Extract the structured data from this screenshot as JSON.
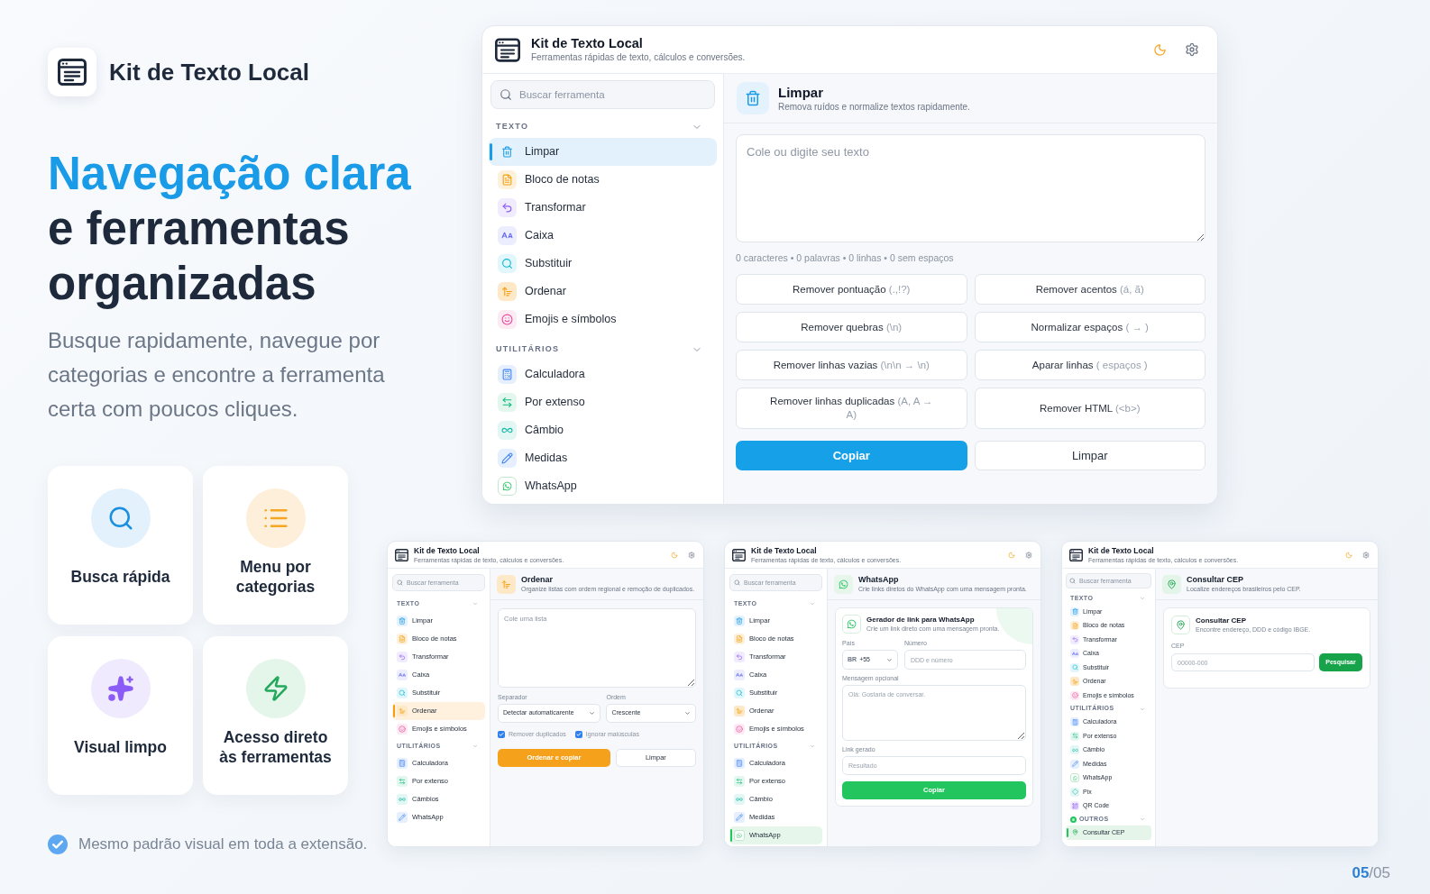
{
  "brand": {
    "name": "Kit de Texto Local"
  },
  "headline": {
    "highlight": "Navegação clara",
    "text": "e ferramentas organizadas"
  },
  "description": "Busque rapidamente, navegue por categorias e encontre a ferramenta certa com poucos cliques.",
  "features": [
    {
      "title": "Busca rápida"
    },
    {
      "title": "Menu por categorias"
    },
    {
      "title": "Visual limpo"
    },
    {
      "title": "Acesso direto às ferramentas"
    }
  ],
  "footer_note": "Mesmo padrão visual em toda a extensão.",
  "windows": [
    {
      "title": "Kit de Texto Local",
      "subtitle": "Ferramentas rápidas de texto, cálculos e conversões.",
      "sidebar": {
        "search": {
          "placeholder": "Buscar ferramenta"
        },
        "sections": [
          {
            "label": "TEXTO",
            "expanded": true,
            "items": [
              {
                "label": "Limpar",
                "selected": true
              },
              {
                "label": "Bloco de notas",
                "selected": false
              },
              {
                "label": "Transformar",
                "selected": false
              },
              {
                "label": "Caixa",
                "selected": false
              },
              {
                "label": "Substituir",
                "selected": false
              },
              {
                "label": "Ordenar",
                "selected": false
              },
              {
                "label": "Emojis e símbolos",
                "selected": false
              }
            ]
          },
          {
            "label": "UTILITÁRIOS",
            "expanded": true,
            "items": [
              {
                "label": "Calculadora",
                "selected": false
              },
              {
                "label": "Por extenso",
                "selected": false
              },
              {
                "label": "Câmbio",
                "selected": false
              },
              {
                "label": "Medidas",
                "selected": false
              },
              {
                "label": "WhatsApp",
                "selected": false
              }
            ]
          }
        ]
      },
      "tool": {
        "kind": "clean",
        "title": "Limpar",
        "description": "Remova ruídos e normalize textos rapidamente.",
        "input": {
          "placeholder": "Cole ou digite seu texto"
        },
        "stats": "0 caracteres • 0 palavras • 0 linhas • 0 sem espaços",
        "actions": [
          {
            "label": "Remover pontuação",
            "hint": "(.,!?)"
          },
          {
            "label": "Remover acentos",
            "hint": "(á, ã)"
          },
          {
            "label": "Remover quebras",
            "hint": "(\\n)"
          },
          {
            "label": "Normalizar espaços",
            "hint": "( → )"
          },
          {
            "label": "Remover linhas vazias",
            "hint": "(\\n\\n → \\n)"
          },
          {
            "label": "Aparar linhas",
            "hint": "( espaços )"
          },
          {
            "label": "Remover linhas duplicadas",
            "hint": "(A, A → A)"
          },
          {
            "label": "Remover HTML",
            "hint": "(<b>)"
          }
        ],
        "buttons": [
          {
            "label": "Copiar",
            "kind": "primary"
          },
          {
            "label": "Limpar",
            "kind": "secondary"
          }
        ]
      }
    },
    {
      "title": "Kit de Texto Local",
      "subtitle": "Ferramentas rápidas de texto, cálculos e conversões.",
      "sidebar": {
        "search": {
          "placeholder": "Buscar ferramenta"
        },
        "sections": [
          {
            "label": "TEXTO",
            "expanded": true,
            "items": [
              {
                "label": "Limpar",
                "selected": false
              },
              {
                "label": "Bloco de notas",
                "selected": false
              },
              {
                "label": "Transformar",
                "selected": false
              },
              {
                "label": "Caixa",
                "selected": false
              },
              {
                "label": "Substituir",
                "selected": false
              },
              {
                "label": "Ordenar",
                "selected": true
              },
              {
                "label": "Emojis e símbolos",
                "selected": false
              }
            ]
          },
          {
            "label": "UTILITÁRIOS",
            "expanded": true,
            "items": [
              {
                "label": "Calculadora",
                "selected": false
              },
              {
                "label": "Por extenso",
                "selected": false
              },
              {
                "label": "Câmbios",
                "selected": false
              },
              {
                "label": "WhatsApp",
                "selected": false
              }
            ]
          }
        ]
      },
      "tool": {
        "kind": "sort",
        "title": "Ordenar",
        "description": "Organize listas com ordem regional e remoção de duplicados.",
        "input": {
          "placeholder": "Cole uma lista"
        },
        "selects": [
          {
            "label": "Separador",
            "value": "Detectar automaticarente"
          },
          {
            "label": "Ordem",
            "value": "Crescente"
          }
        ],
        "options": [
          {
            "label": "Remover duplicados",
            "checked": true
          },
          {
            "label": "Ignorar maiúsculas",
            "checked": true
          }
        ],
        "buttons": [
          {
            "label": "Ordenar e copiar",
            "kind": "primary"
          },
          {
            "label": "Limpar",
            "kind": "secondary"
          }
        ]
      }
    },
    {
      "title": "Kit de Texto Local",
      "subtitle": "Ferramentas rápidas de texto, cálculos e conversões.",
      "sidebar": {
        "search": {
          "placeholder": "Buscar ferramenta"
        },
        "sections": [
          {
            "label": "TEXTO",
            "expanded": true,
            "items": [
              {
                "label": "Limpar",
                "selected": false
              },
              {
                "label": "Bloco de notas",
                "selected": false
              },
              {
                "label": "Transformar",
                "selected": false
              },
              {
                "label": "Caixa",
                "selected": false
              },
              {
                "label": "Substituir",
                "selected": false
              },
              {
                "label": "Ordenar",
                "selected": false
              },
              {
                "label": "Emojis e símbolos",
                "selected": false
              }
            ]
          },
          {
            "label": "UTILITÁRIOS",
            "expanded": true,
            "items": [
              {
                "label": "Calculadora",
                "selected": false
              },
              {
                "label": "Por extenso",
                "selected": false
              },
              {
                "label": "Câmbio",
                "selected": false
              },
              {
                "label": "Medidas",
                "selected": false
              },
              {
                "label": "WhatsApp",
                "selected": true
              }
            ]
          }
        ]
      },
      "tool": {
        "kind": "whatsapp",
        "title": "WhatsApp",
        "description": "Crie links diretos do WhatsApp com uma mensagem pronta.",
        "card": {
          "title": "Gerador de link para WhatsApp",
          "description": "Crie um link direto com uma mensagem pronta.",
          "country": {
            "label": "País",
            "flag": "BR",
            "value": "+55"
          },
          "phone": {
            "label": "Número",
            "placeholder": "DDD e número"
          },
          "message": {
            "label": "Mensagem opcional",
            "placeholder": "Olá: Gostaria de conversar."
          },
          "link": {
            "label": "Link gerado",
            "placeholder": "Resultado"
          },
          "button": {
            "label": "Copiar"
          }
        }
      }
    },
    {
      "title": "Kit de Texto Local",
      "subtitle": "Ferramentas rápidas de texto, cálculos e conversões.",
      "sidebar": {
        "search": {
          "placeholder": "Buscar ferramenta"
        },
        "sections": [
          {
            "label": "TEXTO",
            "expanded": true,
            "items": [
              {
                "label": "Limpar",
                "selected": false
              },
              {
                "label": "Bloco de notas",
                "selected": false
              },
              {
                "label": "Transformar",
                "selected": false
              },
              {
                "label": "Caixa",
                "selected": false
              },
              {
                "label": "Substituir",
                "selected": false
              },
              {
                "label": "Ordenar",
                "selected": false
              },
              {
                "label": "Emojis e símbolos",
                "selected": false
              }
            ]
          },
          {
            "label": "UTILITÁRIOS",
            "expanded": true,
            "items": [
              {
                "label": "Calculadora",
                "selected": false
              },
              {
                "label": "Por extenso",
                "selected": false
              },
              {
                "label": "Câmbio",
                "selected": false
              },
              {
                "label": "Medidas",
                "selected": false
              },
              {
                "label": "WhatsApp",
                "selected": false
              },
              {
                "label": "Pix",
                "selected": false
              },
              {
                "label": "QR Code",
                "selected": false
              }
            ]
          },
          {
            "label": "OUTROS",
            "expanded": true,
            "items": [
              {
                "label": "Consultar CEP",
                "selected": true
              }
            ]
          }
        ]
      },
      "tool": {
        "kind": "cep",
        "title": "Consultar CEP",
        "description": "Localize endereços brasileiros pelo CEP.",
        "card": {
          "title": "Consultar CEP",
          "description": "Encontre endereço, DDD e código IBGE.",
          "field": {
            "label": "CEP",
            "placeholder": "00000-000"
          },
          "button": {
            "label": "Pesquisar"
          }
        }
      }
    }
  ],
  "page": "**05**/05"
}
